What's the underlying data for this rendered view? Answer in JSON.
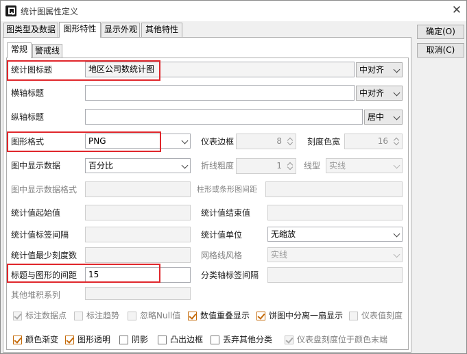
{
  "window": {
    "title": "统计图属性定义",
    "accent_color": "#e0262b"
  },
  "tabs": [
    {
      "label": "图类型及数据"
    },
    {
      "label": "图形特性"
    },
    {
      "label": "显示外观"
    },
    {
      "label": "其他特性"
    }
  ],
  "subtabs": [
    {
      "label": "常规"
    },
    {
      "label": "警戒线"
    }
  ],
  "buttons": {
    "ok": "确定(O)",
    "cancel": "取消(C)"
  },
  "fields": {
    "chart_title": {
      "label": "统计图标题",
      "value": "地区公司数统计图",
      "align": "中对齐"
    },
    "x_axis_title": {
      "label": "横轴标题",
      "value": "",
      "align": "中对齐"
    },
    "y_axis_title": {
      "label": "纵轴标题",
      "value": "",
      "align": "居中"
    },
    "image_format": {
      "label": "图形格式",
      "value": "PNG"
    },
    "gauge_border": {
      "label": "仪表边框",
      "value": "8"
    },
    "scale_color_width": {
      "label": "刻度色宽",
      "value": "16"
    },
    "display_data": {
      "label": "图中显示数据",
      "value": "百分比"
    },
    "line_thickness": {
      "label": "折线粗度",
      "value": "1"
    },
    "line_type": {
      "label": "线型",
      "value": "实线"
    },
    "display_data_format": {
      "label": "图中显示数据格式",
      "value": ""
    },
    "bar_spacing": {
      "label": "柱形或条形图间距",
      "value": ""
    },
    "stat_start": {
      "label": "统计值起始值",
      "value": ""
    },
    "stat_end": {
      "label": "统计值结束值",
      "value": ""
    },
    "stat_label_interval": {
      "label": "统计值标签间隔",
      "value": ""
    },
    "stat_unit": {
      "label": "统计值单位",
      "value": "无缩放"
    },
    "stat_min_ticks": {
      "label": "统计值最少刻度数",
      "value": ""
    },
    "grid_style": {
      "label": "网格线风格",
      "value": "实线"
    },
    "title_spacing": {
      "label": "标题与图形的间距",
      "value": "15"
    },
    "category_label_interval": {
      "label": "分类轴标签间隔",
      "value": ""
    },
    "other_stack_series": {
      "label": "其他堆积系列",
      "value": ""
    }
  },
  "checkboxes_row1": [
    {
      "label": "标注数据点",
      "checked": true,
      "disabled": true
    },
    {
      "label": "标注趋势",
      "checked": false,
      "disabled": true
    },
    {
      "label": "忽略Null值",
      "checked": false,
      "disabled": true
    },
    {
      "label": "数值重叠显示",
      "checked": true,
      "disabled": false
    },
    {
      "label": "饼图中分离一扇显示",
      "checked": true,
      "disabled": false
    },
    {
      "label": "仪表值刻度",
      "checked": false,
      "disabled": true
    }
  ],
  "checkboxes_row2": [
    {
      "label": "颜色渐变",
      "checked": true,
      "disabled": false
    },
    {
      "label": "图形透明",
      "checked": true,
      "disabled": false
    },
    {
      "label": "阴影",
      "checked": false,
      "disabled": false
    },
    {
      "label": "凸出边框",
      "checked": false,
      "disabled": false
    },
    {
      "label": "丢弃其他分类",
      "checked": false,
      "disabled": false
    },
    {
      "label": "仪表盘刻度位于颜色末端",
      "checked": true,
      "disabled": true
    }
  ]
}
